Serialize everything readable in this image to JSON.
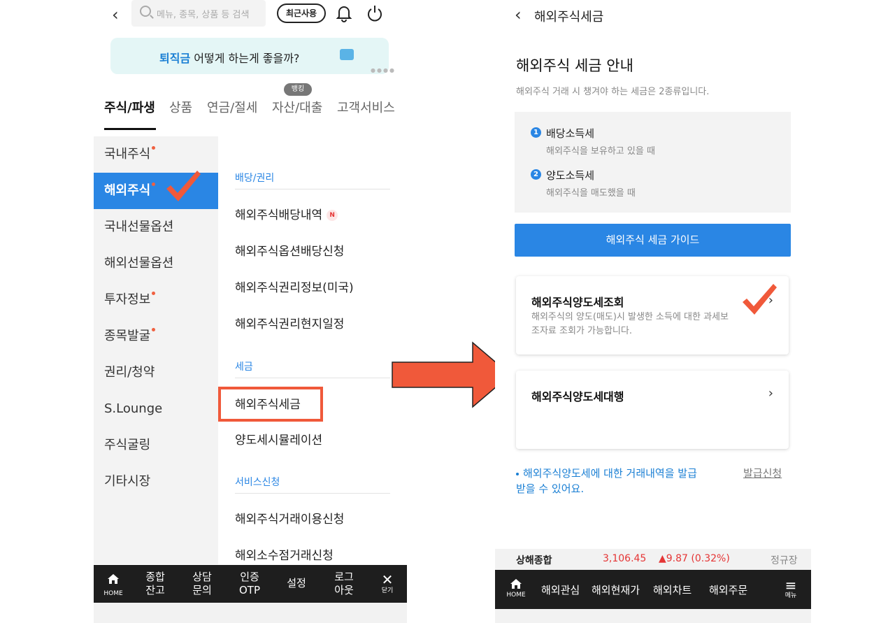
{
  "left_screen": {
    "search": {
      "placeholder": "메뉴, 종목, 상품 등 검색"
    },
    "recent_button": "최근사용",
    "banner": {
      "highlight": "퇴직금",
      "text": " 어떻게 하는게 좋을까?"
    },
    "banking_badge": "뱅킹",
    "tabs": [
      "주식/파생",
      "상품",
      "연금/절세",
      "자산/대출",
      "고객서비스"
    ],
    "categories": [
      "국내주식",
      "해외주식",
      "국내선물옵션",
      "해외선물옵션",
      "투자정보",
      "종목발굴",
      "권리/청약",
      "S.Lounge",
      "주식굴링",
      "기타시장"
    ],
    "sections": {
      "dividend": {
        "header": "배당/권리",
        "items": [
          "해외주식배당내역",
          "해외주식옵션배당신청",
          "해외주식권리정보(미국)",
          "해외주식권리현지일정"
        ],
        "new_badge": "N"
      },
      "tax": {
        "header": "세금",
        "items": [
          "해외주식세금",
          "양도세시뮬레이션"
        ]
      },
      "service": {
        "header": "서비스신청",
        "items": [
          "해외주식거래이용신청",
          "해외소수점거래신청"
        ]
      }
    },
    "bottom_bar": {
      "home": "HOME",
      "items": [
        "종합\n잔고",
        "상담\n문의",
        "인증\nOTP",
        "설정",
        "로그\n아웃"
      ],
      "close": "닫기"
    }
  },
  "right_screen": {
    "title": "해외주식세금",
    "heading": "해외주식 세금 안내",
    "description": "해외주식 거래 시 챙겨야 하는 세금은 2종류입니다.",
    "taxes": [
      {
        "num": "1",
        "name": "배당소득세",
        "desc": "해외주식을 보유하고 있을 때"
      },
      {
        "num": "2",
        "name": "양도소득세",
        "desc": "해외주식을 매도했을 때"
      }
    ],
    "guide_button": "해외주식 세금 가이드",
    "cards": [
      {
        "title": "해외주식양도세조회",
        "desc": "해외주식의 양도(매도)시 발생한 소득에 대한 과세보조자료 조회가 가능합니다."
      },
      {
        "title": "해외주식양도세대행",
        "desc": ""
      }
    ],
    "note": "해외주식양도세에 대한 거래내역을 발급받을 수 있어요.",
    "issue_link": "발급신청",
    "ticker": {
      "name": "상해종합",
      "value": "3,106.45",
      "change": "▲9.87 (0.32%)",
      "session": "정규장"
    },
    "bottom_bar": {
      "home": "HOME",
      "items": [
        "해외관심",
        "해외현재가",
        "해외차트",
        "해외주문"
      ],
      "menu": "메뉴"
    }
  },
  "colors": {
    "accent_blue": "#2a86e4",
    "annotation_red": "#f0593a",
    "up_red": "#e53535",
    "banner_bg": "#e4f6f6"
  },
  "icons": [
    "back-chevron-icon",
    "search-icon",
    "bell-icon",
    "power-icon",
    "briefcase-icon",
    "home-icon",
    "close-icon",
    "menu-icon",
    "checkmark-icon",
    "right-arrow-icon"
  ]
}
